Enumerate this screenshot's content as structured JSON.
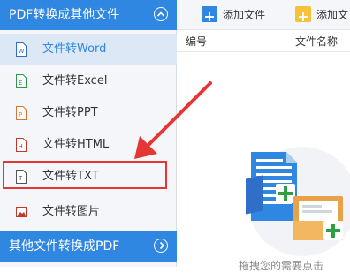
{
  "sidebar": {
    "header_label": "PDF转换成其他文件",
    "items": [
      {
        "label": "文件转Word",
        "icon": "word-file-icon",
        "active": true
      },
      {
        "label": "文件转Excel",
        "icon": "excel-file-icon"
      },
      {
        "label": "文件转PPT",
        "icon": "ppt-file-icon"
      },
      {
        "label": "文件转HTML",
        "icon": "html-file-icon"
      },
      {
        "label": "文件转TXT",
        "icon": "txt-file-icon"
      },
      {
        "label": "文件转图片",
        "icon": "image-file-icon"
      }
    ],
    "footer_label": "其他文件转换成PDF"
  },
  "toolbar": {
    "add_file": "添加文件",
    "add_folder": "添加文"
  },
  "table": {
    "col_number": "编号",
    "col_filename": "文件名称"
  },
  "empty_hint": "拖拽您的需要点击",
  "colors": {
    "accent": "#2f87e2",
    "highlight": "#e53535",
    "add_folder_icon": "#f5c23a"
  }
}
